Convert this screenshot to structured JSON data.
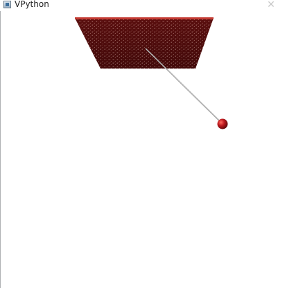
{
  "window": {
    "title": "VPython",
    "icon": "vpython-app-icon",
    "close_icon": "close-icon",
    "close_glyph": "✕"
  },
  "scene": {
    "objects": [
      "ceiling-slab",
      "pendulum-string",
      "pendulum-bob"
    ],
    "colors": {
      "ceiling": "#5a0f0f",
      "ceiling_edge": "#c43a32",
      "string": "#8a8a8a",
      "bob": "#b3141a",
      "background": "#ffffff"
    }
  }
}
